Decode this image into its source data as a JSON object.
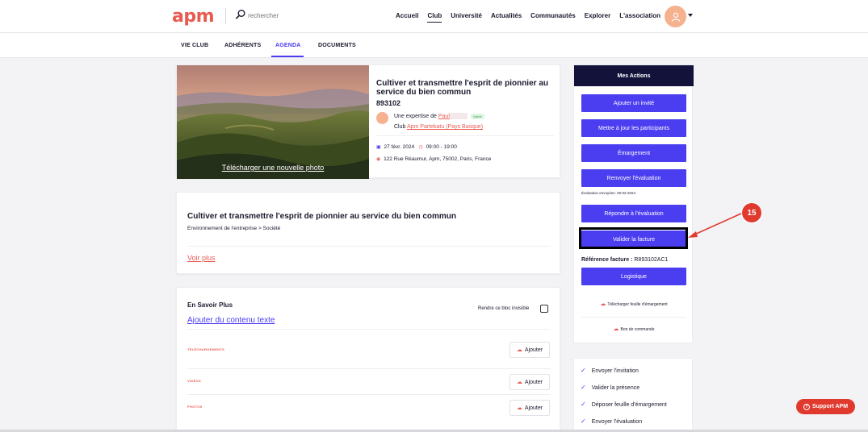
{
  "header": {
    "logo": "apm",
    "search_placeholder": "rechercher",
    "nav": [
      "Accueil",
      "Club",
      "Université",
      "Actualités",
      "Communautés",
      "Explorer",
      "L'association"
    ],
    "nav_active": "Club"
  },
  "subtabs": [
    "VIE CLUB",
    "ADHÉRENTS",
    "AGENDA",
    "DOCUMENTS"
  ],
  "subtab_active": "AGENDA",
  "event": {
    "upload_photo": "Télécharger une nouvelle photo",
    "title": "Cultiver et transmettre l'esprit de pionnier au service du bien commun",
    "code": "893102",
    "expert_prefix": "Une expertise de",
    "expert_name": "Paul",
    "expert_badge": "Validé",
    "club_prefix": "Club",
    "club_name": "Apm Partekatu (Pays Basque)",
    "date": "27 févr. 2024",
    "time": "09:00 - 19:00",
    "address": "122 Rue Réaumur, Apm, 75002, Paris, France"
  },
  "description": {
    "title": "Cultiver et transmettre l'esprit de pionnier au service du bien commun",
    "breadcrumb": "Environnement de l'entreprise > Société",
    "see_more": "Voir plus"
  },
  "more": {
    "title": "En Savoir Plus",
    "invisible_label": "Rendre ce bloc invisible",
    "add_text": "Ajouter du contenu texte",
    "sections": [
      {
        "label": "TÉLÉCHARGEMENTS",
        "button": "Ajouter"
      },
      {
        "label": "VIDÉOS",
        "button": "Ajouter"
      },
      {
        "label": "PHOTOS",
        "button": "Ajouter"
      }
    ]
  },
  "actions": {
    "title": "Mes Actions",
    "buttons": [
      "Ajouter un invité",
      "Mettre à jour les participants",
      "Émargement",
      "Renvoyer l'évaluation",
      "Répondre à l'évaluation",
      "Valider la facture",
      "Logistique"
    ],
    "evaluation_note": "Évaluation envoyées: 29-02-2024",
    "invoice_ref_label": "Référence facture :",
    "invoice_ref": "R893102AC1",
    "download_sheet": "Télécharger feuille d'émargement",
    "purchase_order": "Bon de commande"
  },
  "checklist": [
    "Envoyer l'invitation",
    "Valider la présence",
    "Déposer feuille d'émargement",
    "Envoyer l'évaluation"
  ],
  "step_marker": "15",
  "support": "Support APM",
  "colors": {
    "brand": "#e85b52",
    "primary": "#4b3df0",
    "dark": "#12123a",
    "marker": "#e03a2e"
  }
}
